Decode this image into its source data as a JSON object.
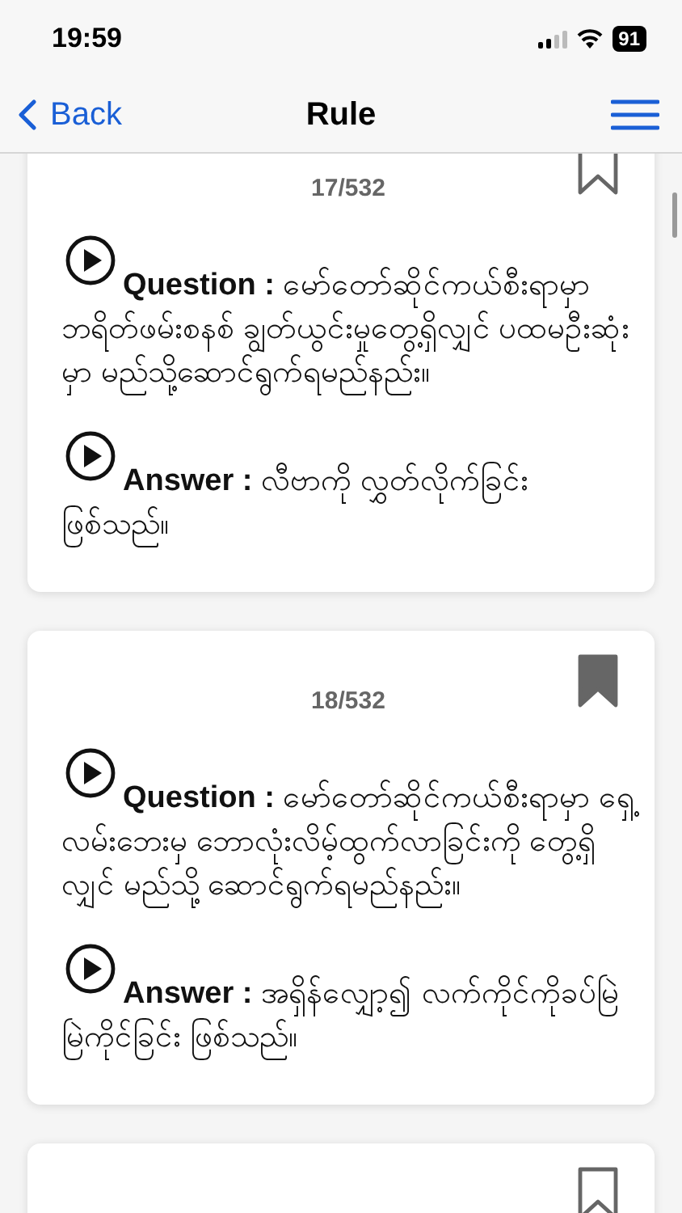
{
  "status_bar": {
    "time": "19:59",
    "battery": "91"
  },
  "nav": {
    "back": "Back",
    "title": "Rule"
  },
  "cards": [
    {
      "counter": "17/532",
      "bookmarked": false,
      "question_label": "Question :",
      "question": "မော်တော်ဆိုင်ကယ်စီးရာမှာ ဘရိတ်ဖမ်းစနစ် ချွတ်ယွင်းမှုတွေ့ရှိလျှင် ပထမဦးဆုံးမှာ မည်သို့ဆောင်ရွက်ရမည်နည်း။",
      "answer_label": "Answer :",
      "answer": "လီဗာကို လွှတ်လိုက်ခြင်းဖြစ်သည်။"
    },
    {
      "counter": "18/532",
      "bookmarked": true,
      "question_label": "Question :",
      "question": "မော်တော်ဆိုင်ကယ်စီးရာမှာ ရှေ့လမ်းဘေးမှ ဘောလုံးလိမ့်ထွက်လာခြင်းကို တွေ့ရှိလျှင် မည်သို့ ဆောင်ရွက်ရမည်နည်း။",
      "answer_label": "Answer :",
      "answer": "အရှိန်လျှော့၍ လက်ကိုင်ကိုခပ်မြဲမြဲကိုင်ခြင်း ဖြစ်သည်။"
    },
    {
      "bookmarked": false
    }
  ]
}
